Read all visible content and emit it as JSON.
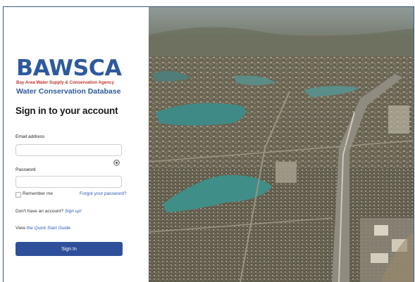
{
  "logo": {
    "word": "BAWSCA",
    "tagline": "Bay Area Water Supply & Conservation Agency"
  },
  "app_subtitle": "Water Conservation Database",
  "form": {
    "heading": "Sign in to your account",
    "email_label": "Email address",
    "email_value": "",
    "password_label": "Password",
    "password_value": "",
    "remember_label": "Remember me",
    "forgot_link": "Forgot your password?",
    "no_account_text": "Don't have an account?",
    "signup_link": "Sign up!",
    "view_text": "View",
    "quick_start_link": "the Quick Start Guide",
    "signin_label": "Sign In"
  },
  "hero_image": {
    "description_icon": "aerial-city-photo-icon"
  },
  "colors": {
    "brand_blue": "#2e5a9c",
    "brand_red": "#c2362b",
    "button": "#2e4f9a",
    "link": "#2a5bb5"
  }
}
